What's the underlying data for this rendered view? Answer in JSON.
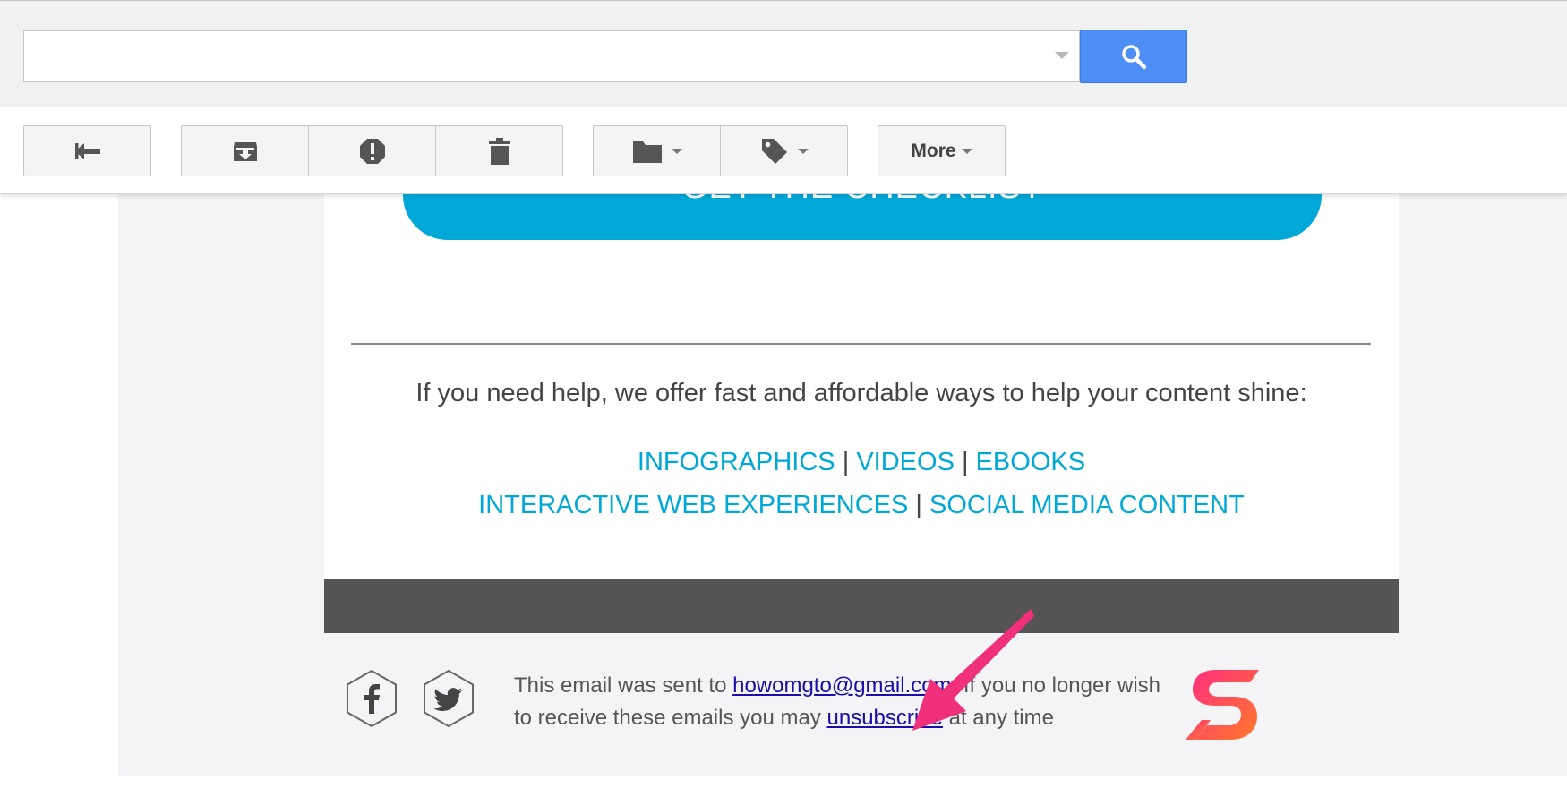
{
  "search": {
    "value": "",
    "placeholder": ""
  },
  "toolbar": {
    "more_label": "More"
  },
  "email": {
    "cta_label": "GET THE CHECKLIST",
    "help_text": "If you need help, we offer fast and affordable ways to help your content shine:",
    "services": {
      "infographics": "INFOGRAPHICS",
      "videos": "VIDEOS",
      "ebooks": "EBOOKS",
      "interactive": "INTERACTIVE WEB EXPERIENCES",
      "social": "SOCIAL MEDIA CONTENT",
      "separator": "|"
    },
    "footer": {
      "text_before_email": "This email was sent to ",
      "email_link": "howomgto@gmail.com",
      "text_after_email": ". If you no longer wish to receive these emails you may ",
      "unsubscribe_link": "unsubscribe",
      "text_after_unsubscribe": " at any time"
    }
  },
  "icons": {
    "reply": "reply-icon",
    "archive": "archive-icon",
    "spam": "report-spam-icon",
    "delete": "trash-icon",
    "move": "folder-icon",
    "labels": "label-tag-icon",
    "search": "search-icon",
    "facebook": "facebook-icon",
    "twitter": "twitter-icon",
    "logo": "brand-logo-icon",
    "annotation": "annotation-arrow"
  },
  "colors": {
    "search_button": "#4d8ef7",
    "accent": "#00a8d8",
    "dark_bar": "#545454",
    "link": "#1a0dab",
    "arrow": "#f0307a"
  }
}
